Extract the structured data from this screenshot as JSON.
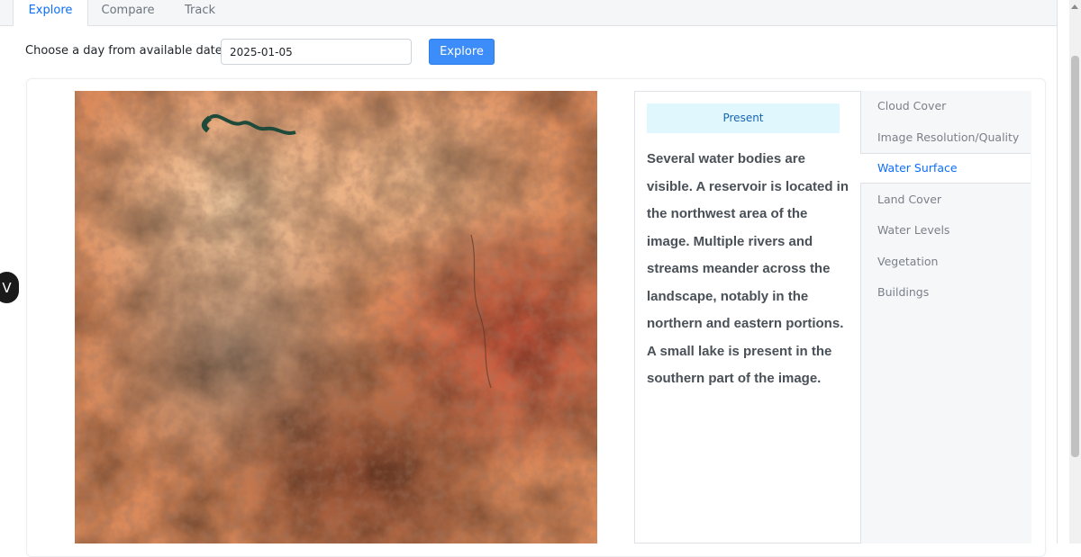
{
  "tabs": [
    {
      "label": "Explore",
      "active": true
    },
    {
      "label": "Compare",
      "active": false
    },
    {
      "label": "Track",
      "active": false
    }
  ],
  "date_picker": {
    "label": "Choose a day from available dates:",
    "value": "2025-01-05",
    "button_label": "Explore"
  },
  "analysis": {
    "period_label": "Present",
    "description": "Several water bodies are visible. A reservoir is located in the northwest area of the image. Multiple rivers and streams meander across the landscape, notably in the northern and eastern portions. A small lake is present in the southern part of the image."
  },
  "categories": [
    {
      "label": "Cloud Cover",
      "active": false
    },
    {
      "label": "Image Resolution/Quality",
      "active": false
    },
    {
      "label": "Water Surface",
      "active": true
    },
    {
      "label": "Land Cover",
      "active": false
    },
    {
      "label": "Water Levels",
      "active": false
    },
    {
      "label": "Vegetation",
      "active": false
    },
    {
      "label": "Buildings",
      "active": false
    }
  ],
  "collapse_glyph": "V",
  "colors": {
    "accent": "#0d6efd",
    "button": "#3c8df9",
    "present_bg": "#dff7fd"
  }
}
